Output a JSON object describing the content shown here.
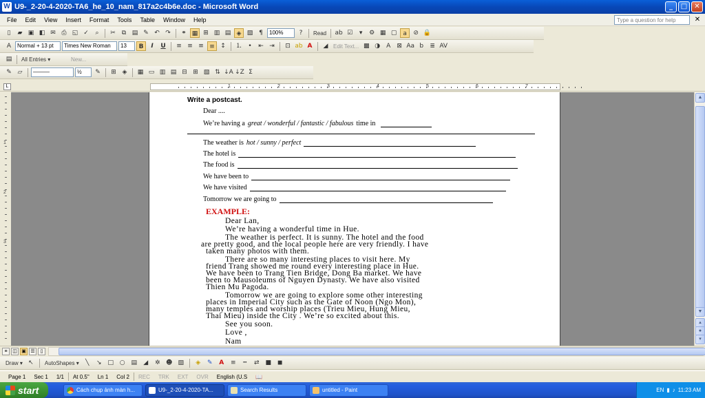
{
  "window": {
    "title": "U9-_2-20-4-2020-TA6_he_10_nam_817a2c4b6e.doc - Microsoft Word",
    "app_icon": "W",
    "buttons": {
      "minimize": "_",
      "maximize": "□",
      "close": "✕"
    }
  },
  "menu": {
    "items": [
      "File",
      "Edit",
      "View",
      "Insert",
      "Format",
      "Tools",
      "Table",
      "Window",
      "Help"
    ],
    "help_placeholder": "Type a question for help",
    "close_doc": "✕"
  },
  "toolbar_standard": {
    "zoom": "100%",
    "read_label": "Read"
  },
  "toolbar_formatting": {
    "style": "Normal + 13 pt",
    "font": "Times New Roman",
    "size": "13",
    "bold": "B",
    "italic": "I",
    "underline": "U",
    "edit_text": "Edit Text..."
  },
  "toolbar_third": {
    "all_entries": "All Entries ▾",
    "new": "New...",
    "line_weight": "½"
  },
  "ruler": {
    "numbers": [
      "1",
      "2",
      "3",
      "4",
      "5",
      "6",
      "7"
    ]
  },
  "vruler": {
    "numbers": [
      "1",
      "2",
      "3"
    ]
  },
  "document": {
    "heading": "Write a postcast.",
    "dear": "Dear ....",
    "having_prefix": "We’re having a ",
    "having_options": "great / wonderful / fantastic / fabulous",
    "having_suffix": " time in",
    "weather_prefix": "The weather is ",
    "weather_options": "hot / sunny / perfect",
    "hotel": "The hotel is",
    "food": "The food is",
    "been": "We have been to",
    "visited": "We have visited",
    "tomorrow": "Tomorrow we are going to",
    "example_label": "EXAMPLE:",
    "letter": [
      "Dear Lan,",
      "We’re having a  wonderful time in Hue.",
      "The weather is  perfect. It is sunny. The hotel and the food",
      "are pretty good, and the local people here are very friendly. I have",
      "taken many photos with them.",
      "There  are  so  many  interesting  places  to  visit  here.  My",
      "friend Trang showed me round every interesting place in Hue.",
      "We have been to Trang Tien Bridge, Dong Ba market. We have",
      "been to Mausoleums of Nguyen Dynasty. We have also visited",
      "Thien Mu Pagoda.",
      "Tomorrow  we  are  going  to  explore  some  other  interesting",
      "places in Imperial City such as the Gate of Noon (Ngo Mon),",
      "many  temples  and  worship  places  (Trieu  Mieu,  Hung  Mieu,",
      "Thai Mieu) inside the City . We’re so excited about this.",
      "See you soon.",
      "Love ,",
      "Nam"
    ]
  },
  "drawbar": {
    "draw": "Draw ▾",
    "autoshapes": "AutoShapes ▾"
  },
  "status": {
    "page": "Page  1",
    "sec": "Sec  1",
    "pos": "1/1",
    "at": "At  0.5\"",
    "ln": "Ln  1",
    "col": "Col  2",
    "rec": "REC",
    "trk": "TRK",
    "ext": "EXT",
    "ovr": "OVR",
    "lang": "English (U.S"
  },
  "taskbar": {
    "start": "start",
    "tasks": [
      "Cách chụp ảnh màn h...",
      "U9-_2-20-4-2020-TA...",
      "Search Results",
      "untitled - Paint"
    ],
    "time": "11:23 AM"
  }
}
